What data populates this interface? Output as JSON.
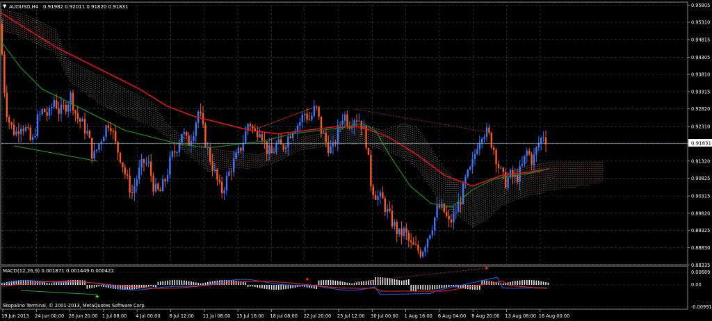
{
  "header": {
    "symbol": "AUDUSD,H4",
    "ohlc": "0.91982 0.92011 0.91820 0.91831"
  },
  "current_price": "0.91831",
  "macd": {
    "label": "MACD(12,26,9) 0.001871 0.001449 0.000422",
    "ticks": [
      "0.00689",
      "0.00",
      "-0.00991"
    ]
  },
  "watermark": "Skopalino Terminal, © 2001-2013, MetaQuotes Software Corp.",
  "colors": {
    "background": "#000000",
    "grid": "#3a4a5a",
    "bull": "#3a78ff",
    "bear": "#ff5a1e",
    "ma_fast": "#e01414",
    "ma_slow": "#1e8c1e",
    "cloud_a": "#ffb48c",
    "cloud_b": "#dcdcdc",
    "macd_line": "#2060ff",
    "signal_line": "#ff2020"
  },
  "chart_data": {
    "type": "candlestick",
    "y_axis": {
      "range": [
        0.8834,
        0.9581
      ],
      "ticks": [
        "0.95805",
        "0.95310",
        "0.94815",
        "0.94305",
        "0.93810",
        "0.93315",
        "0.92820",
        "0.92310",
        "0.91815",
        "0.91320",
        "0.90825",
        "0.90315",
        "0.89820",
        "0.89325",
        "0.88830",
        "0.88335"
      ]
    },
    "x_axis": {
      "ticks": [
        "19 Jun 2013",
        "24 Jun 00:00",
        "26 Jun 20:00",
        "1 Jul 08:00",
        "4 Jul 00:00",
        "8 Jul 12:00",
        "11 Jul 08:00",
        "15 Jul 16:00",
        "18 Jul 08:00",
        "22 Jul 20:00",
        "25 Jul 12:00",
        "30 Jul 00:00",
        "1 Aug 16:00",
        "6 Aug 04:00",
        "8 Aug 20:00",
        "13 Aug 08:00",
        "16 Aug 00:00"
      ]
    },
    "price_path": [
      [
        0,
        0.9525
      ],
      [
        4,
        0.941
      ],
      [
        8,
        0.929
      ],
      [
        14,
        0.924
      ],
      [
        22,
        0.921
      ],
      [
        30,
        0.924
      ],
      [
        38,
        0.922
      ],
      [
        46,
        0.918
      ],
      [
        54,
        0.925
      ],
      [
        62,
        0.928
      ],
      [
        70,
        0.926
      ],
      [
        78,
        0.931
      ],
      [
        86,
        0.927
      ],
      [
        94,
        0.929
      ],
      [
        102,
        0.932
      ],
      [
        110,
        0.926
      ],
      [
        118,
        0.924
      ],
      [
        126,
        0.921
      ],
      [
        134,
        0.914
      ],
      [
        142,
        0.918
      ],
      [
        150,
        0.922
      ],
      [
        158,
        0.925
      ],
      [
        166,
        0.918
      ],
      [
        174,
        0.914
      ],
      [
        182,
        0.908
      ],
      [
        190,
        0.904
      ],
      [
        198,
        0.909
      ],
      [
        206,
        0.913
      ],
      [
        214,
        0.912
      ],
      [
        222,
        0.905
      ],
      [
        230,
        0.904
      ],
      [
        238,
        0.908
      ],
      [
        246,
        0.914
      ],
      [
        254,
        0.917
      ],
      [
        262,
        0.922
      ],
      [
        270,
        0.918
      ],
      [
        278,
        0.922
      ],
      [
        286,
        0.928
      ],
      [
        294,
        0.92
      ],
      [
        302,
        0.914
      ],
      [
        310,
        0.909
      ],
      [
        318,
        0.904
      ],
      [
        326,
        0.908
      ],
      [
        334,
        0.912
      ],
      [
        342,
        0.915
      ],
      [
        350,
        0.919
      ],
      [
        358,
        0.925
      ],
      [
        366,
        0.921
      ],
      [
        374,
        0.923
      ],
      [
        382,
        0.917
      ],
      [
        390,
        0.915
      ],
      [
        398,
        0.918
      ],
      [
        406,
        0.917
      ],
      [
        414,
        0.92
      ],
      [
        422,
        0.923
      ],
      [
        430,
        0.924
      ],
      [
        438,
        0.927
      ],
      [
        446,
        0.925
      ],
      [
        454,
        0.929
      ],
      [
        462,
        0.922
      ],
      [
        470,
        0.918
      ],
      [
        478,
        0.916
      ],
      [
        486,
        0.922
      ],
      [
        494,
        0.927
      ],
      [
        502,
        0.924
      ],
      [
        510,
        0.926
      ],
      [
        518,
        0.925
      ],
      [
        526,
        0.92
      ],
      [
        534,
        0.906
      ],
      [
        542,
        0.903
      ],
      [
        550,
        0.902
      ],
      [
        558,
        0.898
      ],
      [
        566,
        0.895
      ],
      [
        574,
        0.892
      ],
      [
        582,
        0.893
      ],
      [
        590,
        0.889
      ],
      [
        598,
        0.888
      ],
      [
        606,
        0.887
      ],
      [
        614,
        0.891
      ],
      [
        622,
        0.895
      ],
      [
        630,
        0.9
      ],
      [
        638,
        0.899
      ],
      [
        646,
        0.895
      ],
      [
        654,
        0.898
      ],
      [
        662,
        0.902
      ],
      [
        670,
        0.908
      ],
      [
        678,
        0.911
      ],
      [
        686,
        0.918
      ],
      [
        694,
        0.922
      ],
      [
        702,
        0.921
      ],
      [
        710,
        0.917
      ],
      [
        718,
        0.911
      ],
      [
        726,
        0.907
      ],
      [
        734,
        0.909
      ],
      [
        742,
        0.908
      ],
      [
        750,
        0.911
      ],
      [
        758,
        0.916
      ],
      [
        766,
        0.913
      ],
      [
        774,
        0.918
      ],
      [
        782,
        0.921
      ],
      [
        788,
        0.9183
      ]
    ],
    "ma_red": [
      [
        0,
        0.956
      ],
      [
        40,
        0.951
      ],
      [
        80,
        0.946
      ],
      [
        120,
        0.942
      ],
      [
        160,
        0.938
      ],
      [
        200,
        0.934
      ],
      [
        240,
        0.929
      ],
      [
        280,
        0.926
      ],
      [
        320,
        0.924
      ],
      [
        360,
        0.922
      ],
      [
        400,
        0.921
      ],
      [
        440,
        0.922
      ],
      [
        480,
        0.923
      ],
      [
        520,
        0.923
      ],
      [
        560,
        0.92
      ],
      [
        600,
        0.915
      ],
      [
        640,
        0.909
      ],
      [
        680,
        0.906
      ],
      [
        720,
        0.909
      ],
      [
        760,
        0.91
      ],
      [
        790,
        0.911
      ]
    ],
    "ma_green": [
      [
        0,
        0.948
      ],
      [
        30,
        0.94
      ],
      [
        60,
        0.934
      ],
      [
        100,
        0.93
      ],
      [
        140,
        0.926
      ],
      [
        180,
        0.922
      ],
      [
        220,
        0.92
      ],
      [
        260,
        0.918
      ],
      [
        300,
        0.917
      ],
      [
        340,
        0.918
      ],
      [
        380,
        0.919
      ],
      [
        420,
        0.921
      ],
      [
        460,
        0.922
      ],
      [
        500,
        0.923
      ],
      [
        520,
        0.924
      ],
      [
        540,
        0.922
      ],
      [
        560,
        0.915
      ],
      [
        590,
        0.906
      ],
      [
        620,
        0.901
      ],
      [
        650,
        0.9
      ],
      [
        680,
        0.905
      ],
      [
        710,
        0.908
      ],
      [
        740,
        0.909
      ],
      [
        770,
        0.91
      ],
      [
        790,
        0.911
      ]
    ]
  }
}
